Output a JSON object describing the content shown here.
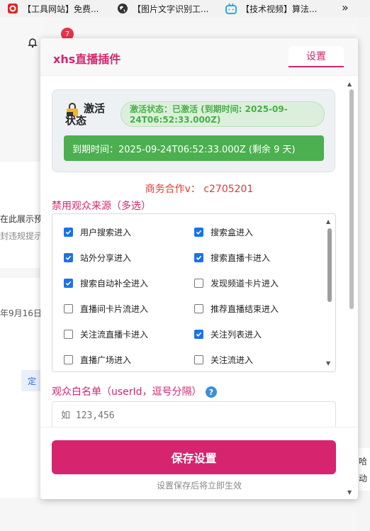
{
  "bookmarks": [
    {
      "label": "【工具网站】免费...",
      "icon": "red-square-icon"
    },
    {
      "label": "【图片文字识别工...",
      "icon": "globe-icon"
    },
    {
      "label": "【技术视频】算法...",
      "icon": "bilibili-tv-icon"
    }
  ],
  "background": {
    "notification_count": "7",
    "line1": "在此展示预",
    "line2": "封违规提示",
    "date": "年9月16日",
    "side_button": "定",
    "right_text1": "哈",
    "right_text2": "动"
  },
  "popup": {
    "title": "xhs直播插件",
    "tab_label": "设置",
    "activation": {
      "label": "激活状态",
      "status_text": "激活状态：已激活 (到期时间: 2025-09-24T06:52:33.000Z)",
      "expiry_text": "到期时间：2025-09-24T06:52:33.000Z (剩余 9 天)"
    },
    "business_contact": "商务合作v：  c2705201",
    "sources_title": "禁用观众来源（多选）",
    "sources": [
      {
        "label": "用户搜索进入",
        "checked": true
      },
      {
        "label": "搜索盒进入",
        "checked": true
      },
      {
        "label": "站外分享进入",
        "checked": true
      },
      {
        "label": "搜索直播卡进入",
        "checked": true
      },
      {
        "label": "搜索自动补全进入",
        "checked": true
      },
      {
        "label": "发现频道卡片进入",
        "checked": false
      },
      {
        "label": "直播间卡片流进入",
        "checked": false
      },
      {
        "label": "推荐直播结束进入",
        "checked": false
      },
      {
        "label": "关注流直播卡进入",
        "checked": false
      },
      {
        "label": "关注列表进入",
        "checked": true
      },
      {
        "label": "直播广场进入",
        "checked": false
      },
      {
        "label": "关注流进入",
        "checked": false
      }
    ],
    "whitelist_title": "观众白名单（userId，逗号分隔）",
    "whitelist_placeholder": "如 123,456",
    "save_label": "保存设置",
    "save_hint": "设置保存后将立即生效"
  },
  "colors": {
    "accent": "#d6246e",
    "success": "#4caf50",
    "checkbox": "#1a73e8",
    "contact": "#e53935"
  }
}
